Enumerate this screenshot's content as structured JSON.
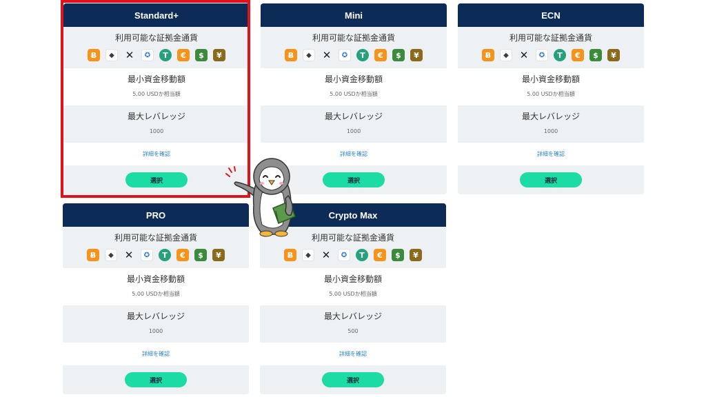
{
  "currency_icons": [
    {
      "name": "bitcoin",
      "glyph": "Ƀ",
      "color": "#f7931a"
    },
    {
      "name": "ethereum",
      "glyph": "◆",
      "color": "#3c3c3d"
    },
    {
      "name": "xrp",
      "glyph": "✕",
      "color": "#222222"
    },
    {
      "name": "usd-coin",
      "glyph": "✪",
      "color": "#2775ca"
    },
    {
      "name": "tether",
      "glyph": "T",
      "color": "#26a17b"
    },
    {
      "name": "euro",
      "glyph": "€",
      "color": "#f7931a"
    },
    {
      "name": "dollar",
      "glyph": "$",
      "color": "#3c8a3c"
    },
    {
      "name": "yen",
      "glyph": "¥",
      "color": "#8b6a1e"
    }
  ],
  "cards": [
    {
      "title": "Standard+",
      "currency_label": "利用可能な証拠金通貨",
      "min_label": "最小資金移動額",
      "min_value": "5.00 USDか相当額",
      "leverage_label": "最大レバレッジ",
      "leverage_value": "1000",
      "detail_link": "詳細を確認",
      "select_label": "選択"
    },
    {
      "title": "Mini",
      "currency_label": "利用可能な証拠金通貨",
      "min_label": "最小資金移動額",
      "min_value": "5.00 USDか相当額",
      "leverage_label": "最大レバレッジ",
      "leverage_value": "1000",
      "detail_link": "詳細を確認",
      "select_label": "選択"
    },
    {
      "title": "ECN",
      "currency_label": "利用可能な証拠金通貨",
      "min_label": "最小資金移動額",
      "min_value": "5.00 USDか相当額",
      "leverage_label": "最大レバレッジ",
      "leverage_value": "1000",
      "detail_link": "詳細を確認",
      "select_label": "選択"
    },
    {
      "title": "PRO",
      "currency_label": "利用可能な証拠金通貨",
      "min_label": "最小資金移動額",
      "min_value": "5.00 USDか相当額",
      "leverage_label": "最大レバレッジ",
      "leverage_value": "1000",
      "detail_link": "詳細を確認",
      "select_label": "選択"
    },
    {
      "title": "Crypto Max",
      "currency_label": "利用可能な証拠金通貨",
      "min_label": "最小資金移動額",
      "min_value": "5.00 USDか相当額",
      "leverage_label": "最大レバレッジ",
      "leverage_value": "500",
      "detail_link": "詳細を確認",
      "select_label": "選択"
    }
  ],
  "colors": {
    "header": "#0d2b57",
    "button": "#1ddba4",
    "highlight": "#e0121c",
    "link": "#2e86c1"
  }
}
